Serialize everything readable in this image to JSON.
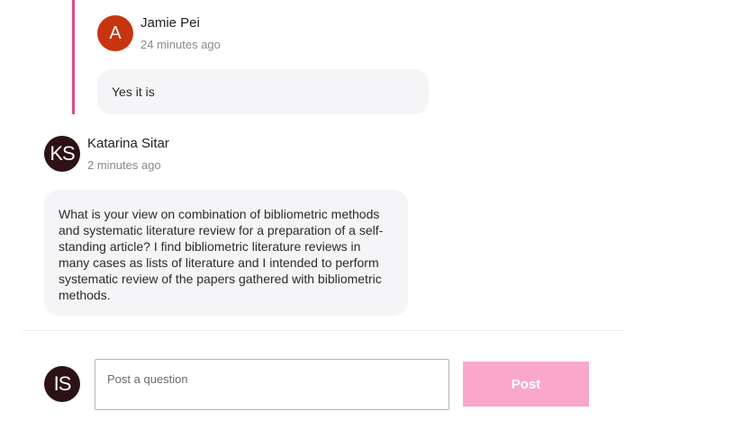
{
  "reply": {
    "avatar_initials": "A",
    "author": "Jamie Pei",
    "time": "24 minutes ago",
    "text": "Yes it is"
  },
  "comment": {
    "avatar_initials": "KS",
    "author": "Katarina Sitar",
    "time": "2 minutes ago",
    "text": "What is your view on combination of bibliometric methods and systematic literature review for a preparation of a self-standing article? I find bibliometric literature reviews in many cases as lists of literature and I intended to perform systematic review of the papers gathered with bibliometric methods."
  },
  "composer": {
    "avatar_initials": "IS",
    "placeholder": "Post a question",
    "value": "",
    "post_label": "Post"
  },
  "colors": {
    "thread_line": "#e14a8c",
    "reply_avatar": "#c8340f",
    "dark_avatar": "#2c1214",
    "post_button": "#f9a8cb",
    "bubble": "#f5f5f7"
  }
}
